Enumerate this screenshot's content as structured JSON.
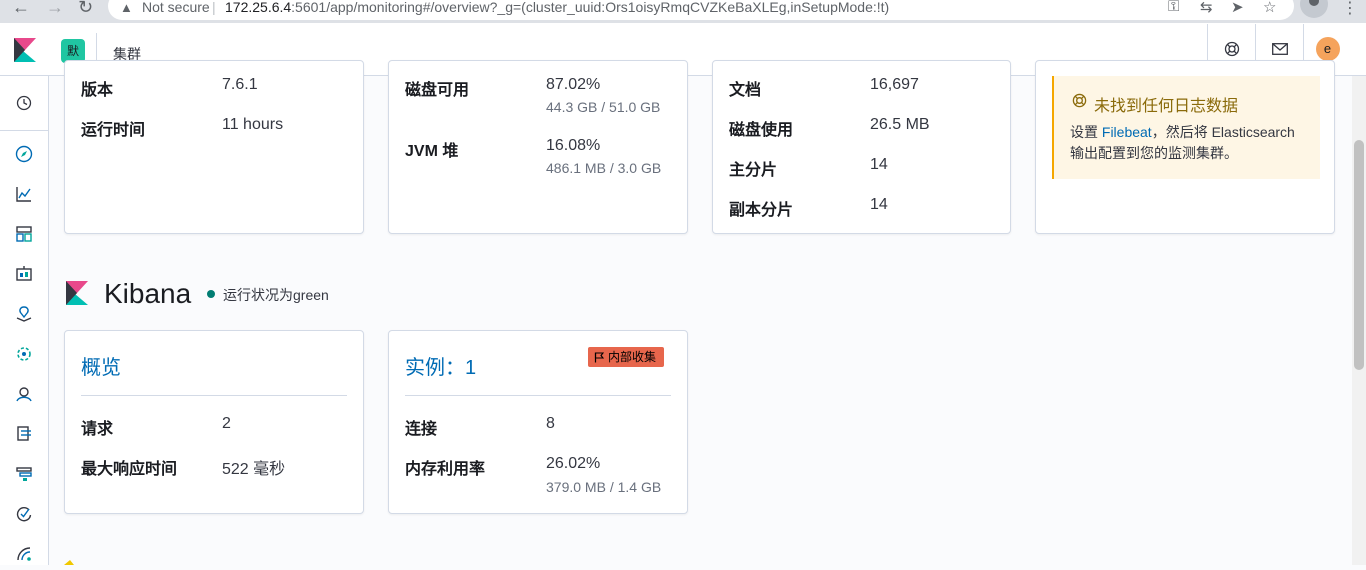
{
  "browser": {
    "security_label": "Not secure",
    "url_host": "172.25.6.4",
    "url_rest": ":5601/app/monitoring#/overview?_g=(cluster_uuid:Ors1oisyRmqCVZKeBaXLEg,inSetupMode:!t)"
  },
  "header": {
    "space_initial": "默",
    "breadcrumb": "集群",
    "user_initial": "e"
  },
  "elasticsearch": {
    "nodes_panel": {
      "version_label": "版本",
      "version_value": "7.6.1",
      "uptime_label": "运行时间",
      "uptime_value": "11 hours"
    },
    "resources_panel": {
      "disk_label": "磁盘可用",
      "disk_value": "87.02%",
      "disk_sub": "44.3 GB / 51.0 GB",
      "jvm_label": "JVM 堆",
      "jvm_value": "16.08%",
      "jvm_sub": "486.1 MB / 3.0 GB"
    },
    "indices_panel": {
      "docs_label": "文档",
      "docs_value": "16,697",
      "disk_usage_label": "磁盘使用",
      "disk_usage_value": "26.5 MB",
      "primary_label": "主分片",
      "primary_value": "14",
      "replica_label": "副本分片",
      "replica_value": "14"
    },
    "logs_callout": {
      "title": "未找到任何日志数据",
      "body_prefix": "设置 ",
      "body_link": "Filebeat",
      "body_suffix": "，然后将 Elasticsearch 输出配置到您的监测集群。"
    }
  },
  "kibana": {
    "title": "Kibana",
    "status_text": "运行状况为green",
    "overview_panel": {
      "title": "概览",
      "requests_label": "请求",
      "requests_value": "2",
      "max_response_label": "最大响应时间",
      "max_response_value": "522 毫秒"
    },
    "instances_panel": {
      "title": "实例：1",
      "badge": "内部收集",
      "connections_label": "连接",
      "connections_value": "8",
      "memory_label": "内存利用率",
      "memory_value": "26.02%",
      "memory_sub": "379.0 MB / 1.4 GB"
    }
  },
  "colors": {
    "accent_link": "#006bb4",
    "status_green": "#017d73",
    "callout_warning": "#f5a700",
    "badge_red": "#e7664c"
  }
}
